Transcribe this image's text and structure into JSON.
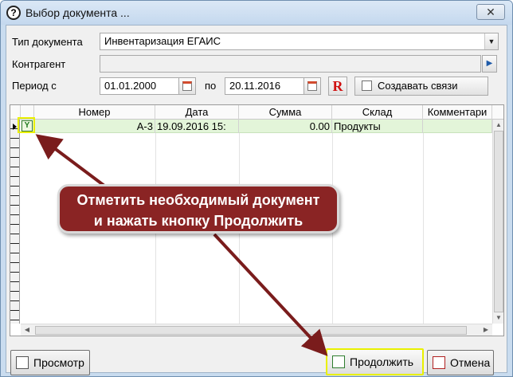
{
  "window": {
    "title": "Выбор документа ...",
    "close_label": "✕"
  },
  "form": {
    "doc_type_label": "Тип документа",
    "doc_type_value": "Инвентаризация ЕГАИС",
    "contractor_label": "Контрагент",
    "contractor_value": "",
    "period_label": "Период с",
    "period_from": "01.01.2000",
    "period_to_label": "по",
    "period_to": "20.11.2016",
    "reset_label": "R",
    "create_links_label": "Создавать связи"
  },
  "grid": {
    "columns": [
      "Номер",
      "Дата",
      "Сумма",
      "Склад",
      "Комментари"
    ],
    "rows": [
      {
        "number": "А-3",
        "date": "19.09.2016 15:",
        "sum": "0.00",
        "warehouse": "Продукты",
        "comment": ""
      }
    ]
  },
  "callout": {
    "line1": "Отметить необходимый документ",
    "line2": "и нажать кнопку Продолжить"
  },
  "buttons": {
    "view_label": "Просмотр",
    "continue_label": "Продолжить",
    "cancel_label": "Отмена"
  },
  "colors": {
    "title_bar": "#c4d8ee",
    "selected_row": "#e3f5d9",
    "callout_fill": "#8a2424",
    "arrow": "#7a1c1c",
    "highlight": "#e9f000"
  }
}
